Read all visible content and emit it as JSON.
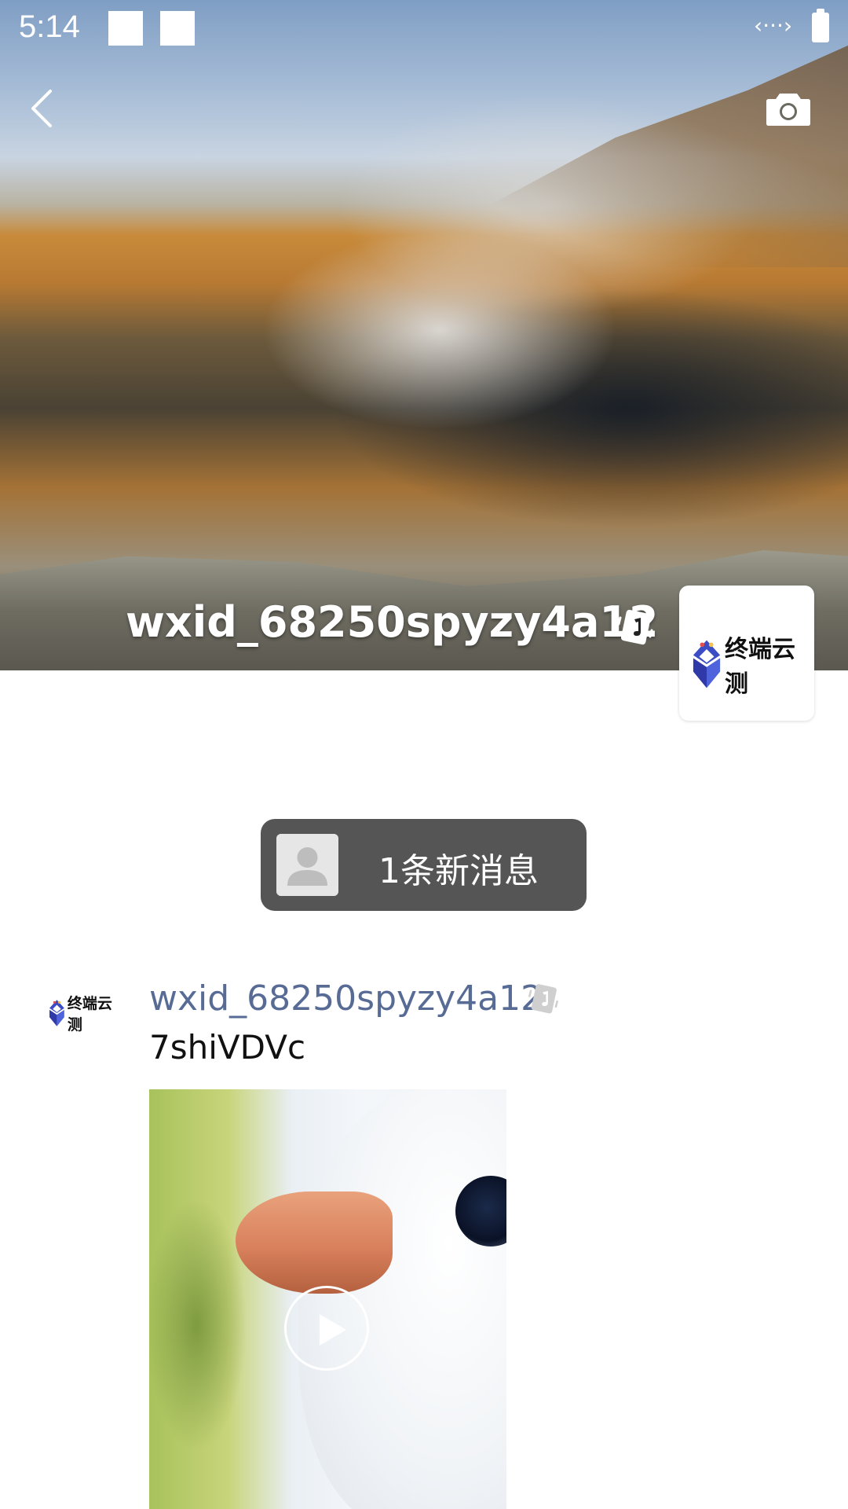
{
  "status_bar": {
    "time": "5:14",
    "icons": [
      "notification-square",
      "notification-square",
      "code-icon",
      "battery-icon"
    ]
  },
  "nav": {
    "back_icon": "chevron-left-icon",
    "camera_icon": "camera-icon"
  },
  "cover": {
    "username": "wxid_68250spyzy4a12",
    "badge_icon": "music-note-badge-icon",
    "avatar_logo_text": "终端云测"
  },
  "notice": {
    "text": "1条新消息",
    "avatar_icon": "default-avatar-icon"
  },
  "post": {
    "avatar_logo_text": "终端云测",
    "username": "wxid_68250spyzy4a12",
    "badge_icon": "music-note-badge-icon",
    "text": "7shiVDVc",
    "media": {
      "type": "video",
      "play_icon": "play-icon"
    }
  },
  "colors": {
    "link_name": "#576b95",
    "pill_bg": "#555555",
    "logo_blue": "#3c4cc4"
  }
}
